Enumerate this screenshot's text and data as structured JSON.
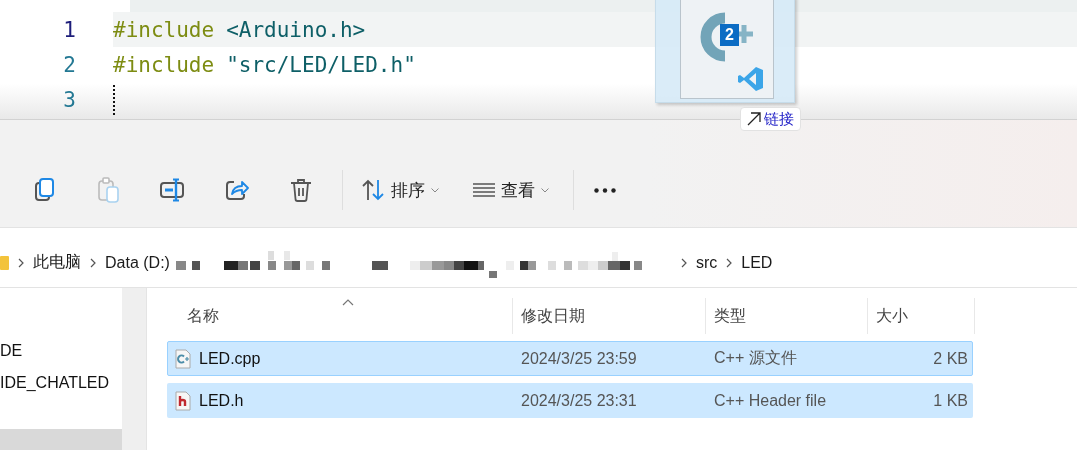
{
  "editor": {
    "lines": [
      {
        "number": "1",
        "current": true,
        "caret": false,
        "tokens": [
          {
            "kind": "directive",
            "text": "#include"
          },
          {
            "kind": "header",
            "text": "<Arduino.h>"
          }
        ]
      },
      {
        "number": "2",
        "current": false,
        "caret": false,
        "tokens": [
          {
            "kind": "directive",
            "text": "#include"
          },
          {
            "kind": "header",
            "text": "\"src/LED/LED.h\""
          }
        ]
      },
      {
        "number": "3",
        "current": false,
        "caret": true
      }
    ]
  },
  "drag": {
    "count": "2",
    "tooltip": "链接"
  },
  "toolbar": {
    "buttons": [
      {
        "kind": "copy",
        "disabled": false
      },
      {
        "kind": "paste",
        "disabled": true
      },
      {
        "kind": "rename",
        "disabled": false
      },
      {
        "kind": "share",
        "disabled": false
      },
      {
        "kind": "delete",
        "disabled": false
      },
      {
        "kind": "sort",
        "label": "排序",
        "disabled": false
      },
      {
        "kind": "view",
        "label": "查看",
        "disabled": false
      },
      {
        "kind": "more",
        "disabled": false
      }
    ]
  },
  "address_bar": {
    "crumbs": [
      {
        "kind": "folder"
      },
      {
        "kind": "text",
        "label": "此电脑"
      },
      {
        "kind": "text",
        "label": "Data (D:)"
      },
      {
        "kind": "redacted"
      },
      {
        "kind": "text",
        "label": "src"
      },
      {
        "kind": "text",
        "label": "LED"
      }
    ]
  },
  "navigation": {
    "items": [
      {
        "label": "DE",
        "selected": false
      },
      {
        "label": "IDE_CHATLED",
        "selected": false
      },
      {
        "selected": true
      }
    ]
  },
  "file_list": {
    "columns": [
      {
        "label": "名称",
        "sorted": true
      },
      {
        "label": "修改日期",
        "sorted": false
      },
      {
        "label": "类型",
        "sorted": false
      },
      {
        "label": "大小",
        "sorted": false
      }
    ],
    "rows": [
      {
        "kind": "cpp",
        "name": "LED.cpp",
        "modified": "2024/3/25 23:59",
        "type": "C++ 源文件",
        "size": "2 KB",
        "selected": true,
        "focused": true
      },
      {
        "kind": "header",
        "name": "LED.h",
        "modified": "2024/3/25 23:31",
        "type": "C++ Header file",
        "size": "1 KB",
        "selected": true,
        "focused": false
      }
    ]
  }
}
